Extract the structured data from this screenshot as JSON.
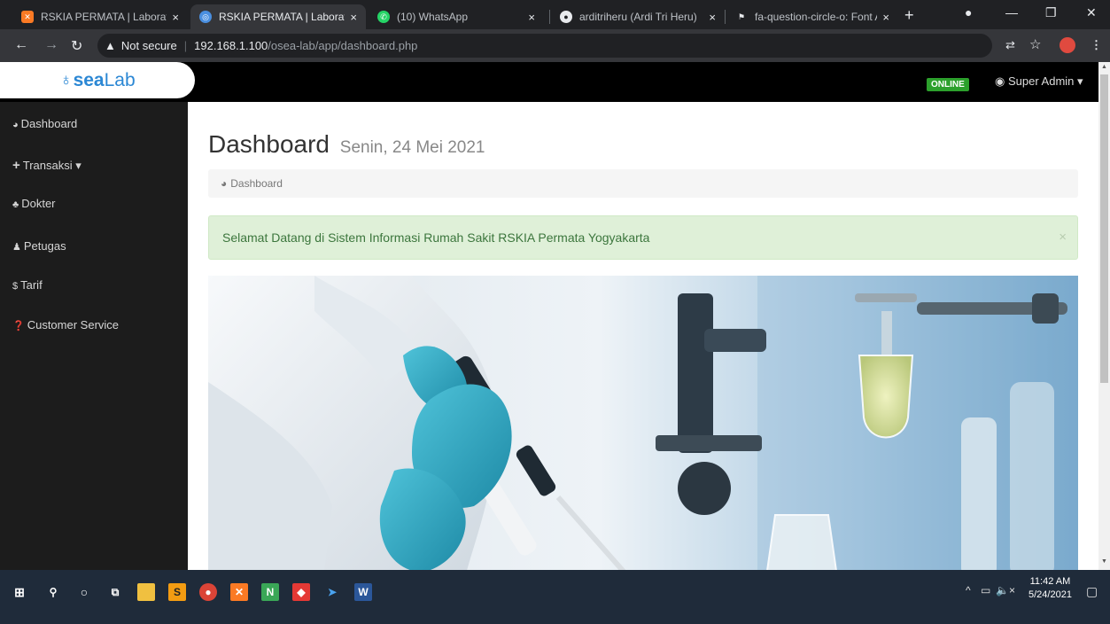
{
  "browser": {
    "tabs": [
      {
        "title": "RSKIA PERMATA | Laboratoriu",
        "icon": "xampp-icon",
        "active": false
      },
      {
        "title": "RSKIA PERMATA | Laboratoriu",
        "icon": "globe-icon",
        "active": true
      },
      {
        "title": "(10) WhatsApp",
        "icon": "whatsapp-icon",
        "active": false
      },
      {
        "title": "arditriheru (Ardi Tri Heru)",
        "icon": "github-icon",
        "active": false
      },
      {
        "title": "fa-question-circle-o: Font Aw",
        "icon": "flag-icon",
        "active": false
      }
    ],
    "close_glyph": "×",
    "new_tab_glyph": "+",
    "address": {
      "warning_glyph": "▲",
      "security_label": "Not secure",
      "separator": "|",
      "host": "192.168.1.100",
      "path": "/osea-lab/app/dashboard.php"
    }
  },
  "app": {
    "logo": {
      "part1": "sea",
      "part2": "Lab",
      "flask_glyph": "♁"
    },
    "status_badge": "ONLINE",
    "user": {
      "name": "Super Admin",
      "caret": "▾"
    }
  },
  "sidebar": {
    "items": [
      {
        "icon": "tachometer-icon",
        "glyph": "◕",
        "label": "Dashboard"
      },
      {
        "icon": "plus-icon",
        "glyph": "+",
        "label": "Transaksi",
        "caret": "▾"
      },
      {
        "icon": "user-md-icon",
        "glyph": "♣",
        "label": "Dokter"
      },
      {
        "icon": "user-icon",
        "glyph": "♟",
        "label": "Petugas"
      },
      {
        "icon": "dollar-icon",
        "glyph": "$",
        "label": "Tarif"
      },
      {
        "icon": "question-circle-icon",
        "glyph": "❓",
        "label": "Customer Service"
      }
    ]
  },
  "main": {
    "title": "Dashboard",
    "date": "Senin, 24 Mei 2021",
    "breadcrumb": {
      "glyph": "◕",
      "label": "Dashboard"
    },
    "alert": {
      "text": "Selamat Datang di Sistem Informasi Rumah Sakit RSKIA Permata Yogyakarta",
      "close": "×"
    }
  },
  "taskbar": {
    "time": "11:42 AM",
    "date": "5/24/2021",
    "tray_caret": "^",
    "tray_volume": "🔈×"
  },
  "colors": {
    "brand": "#2b87d4",
    "online": "#2ca02c",
    "alert_bg": "#dff0d8",
    "alert_text": "#3c763d"
  }
}
